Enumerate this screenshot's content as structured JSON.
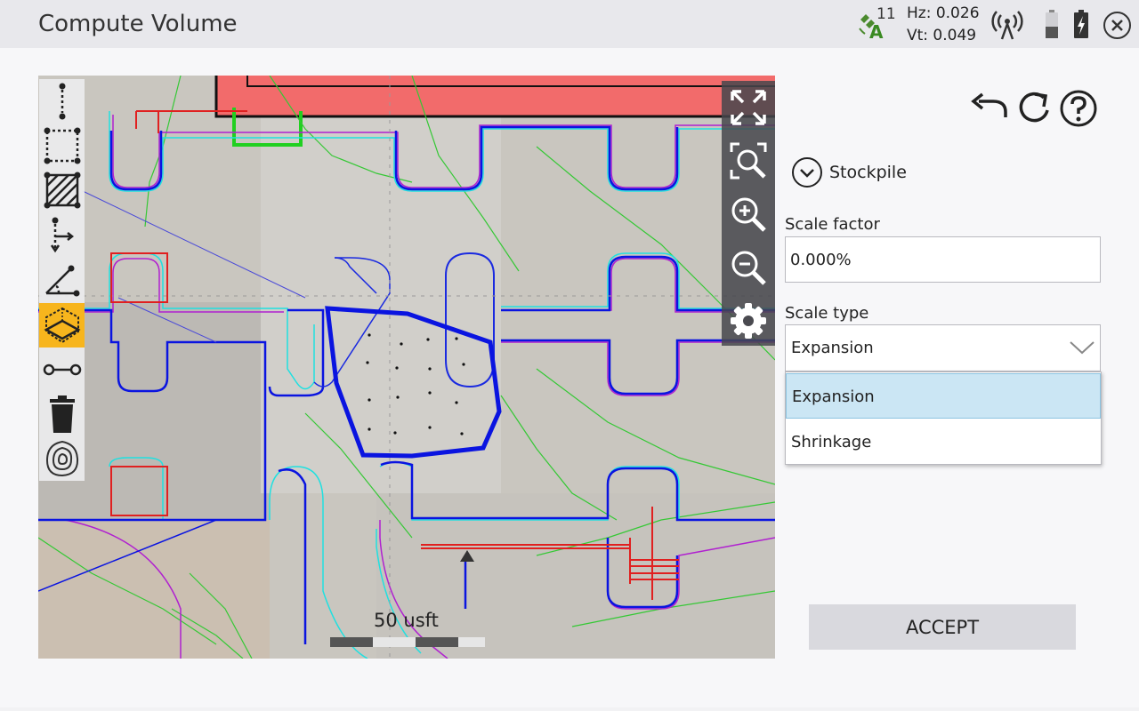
{
  "app": {
    "title": "Compute Volume"
  },
  "status": {
    "satellite_count": "11",
    "hz": "Hz: 0.026",
    "vt": "Vt: 0.049"
  },
  "icons": {
    "satellite": "satellite-rtk-icon",
    "radio": "radio-signal-icon",
    "battery1": "battery-icon",
    "battery2": "battery-charging-icon",
    "close": "close-circle-icon"
  },
  "map": {
    "scale_label": "50 usft"
  },
  "panel": {
    "section_label": "Stockpile",
    "scale_factor_label": "Scale factor",
    "scale_factor_value": "0.000%",
    "scale_type_label": "Scale type",
    "scale_type_value": "Expansion",
    "options": [
      "Expansion",
      "Shrinkage"
    ],
    "accept_label": "ACCEPT"
  },
  "colors": {
    "active_tool": "#f7b51d",
    "selected_option": "#cbe6f4",
    "stockpile_outline": "#0a14e0"
  }
}
